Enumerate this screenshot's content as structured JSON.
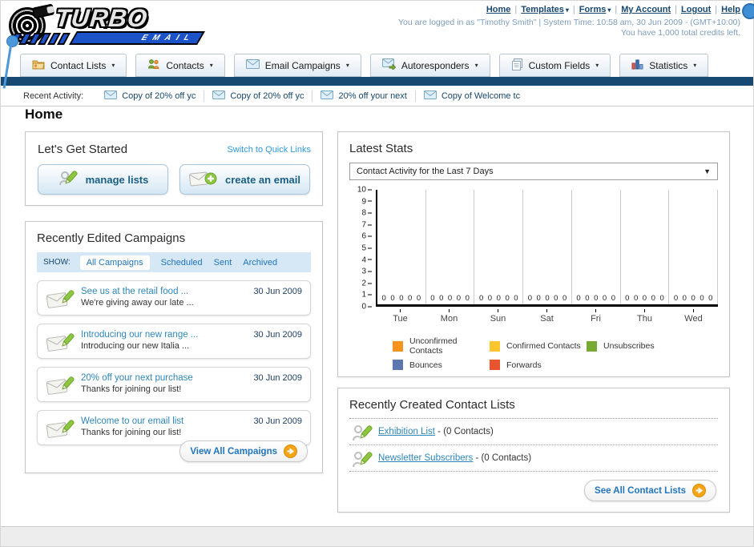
{
  "header": {
    "logo": {
      "title": "TURBO",
      "subtitle": "EMAIL"
    },
    "top_links": [
      {
        "label": "Home",
        "dropdown": false
      },
      {
        "label": "Templates",
        "dropdown": true
      },
      {
        "label": "Forms",
        "dropdown": true
      },
      {
        "label": "My Account",
        "dropdown": false
      },
      {
        "label": "Logout",
        "dropdown": false
      },
      {
        "label": "Help",
        "dropdown": false
      }
    ],
    "login_info": "You are logged in as \"Timothy Smith\" | System Time: 10:58 am, 30 Jun 2009 - (GMT+10:00)",
    "credits_info": "You have 1,000 total credits left."
  },
  "nav_tabs": [
    {
      "label": "Contact Lists",
      "icon": "contact-lists-icon"
    },
    {
      "label": "Contacts",
      "icon": "contacts-icon"
    },
    {
      "label": "Email Campaigns",
      "icon": "email-campaigns-icon"
    },
    {
      "label": "Autoresponders",
      "icon": "autoresponders-icon"
    },
    {
      "label": "Custom Fields",
      "icon": "custom-fields-icon"
    },
    {
      "label": "Statistics",
      "icon": "statistics-icon"
    }
  ],
  "recent_activity": {
    "label": "Recent Activity:",
    "items": [
      "Copy of 20% off yc",
      "Copy of 20% off yc",
      "20% off your next",
      "Copy of Welcome tc"
    ]
  },
  "page_title": "Home",
  "get_started": {
    "title": "Let's Get Started",
    "switch_link": "Switch to Quick Links",
    "buttons": [
      {
        "label": "manage lists",
        "icon": "manage-lists-icon"
      },
      {
        "label": "create an email",
        "icon": "create-email-icon"
      }
    ]
  },
  "campaigns": {
    "title": "Recently Edited Campaigns",
    "show_label": "SHOW:",
    "filters": [
      "All Campaigns",
      "Scheduled",
      "Sent",
      "Archived"
    ],
    "active_filter": "All Campaigns",
    "items": [
      {
        "title": "See us at the retail food ...",
        "subtitle": "We're giving away our late ...",
        "date": "30 Jun 2009"
      },
      {
        "title": "Introducing our new range ...",
        "subtitle": "Introducing our new Italia ...",
        "date": "30 Jun 2009"
      },
      {
        "title": "20% off your next purchase",
        "subtitle": "Thanks for joining our list!",
        "date": "30 Jun 2009"
      },
      {
        "title": "Welcome to our email list",
        "subtitle": "Thanks for joining our list!",
        "date": "30 Jun 2009"
      }
    ],
    "view_all_label": "View All Campaigns"
  },
  "stats": {
    "title": "Latest Stats",
    "dropdown_value": "Contact Activity for the Last 7 Days"
  },
  "chart_data": {
    "type": "bar",
    "title": "Contact Activity for the Last 7 Days",
    "categories": [
      "Tue",
      "Mon",
      "Sun",
      "Sat",
      "Fri",
      "Thu",
      "Wed"
    ],
    "series": [
      {
        "name": "Unconfirmed Contacts",
        "color": "#F6921E",
        "values": [
          0,
          0,
          0,
          0,
          0,
          0,
          0
        ]
      },
      {
        "name": "Confirmed Contacts",
        "color": "#FDC62F",
        "values": [
          0,
          0,
          0,
          0,
          0,
          0,
          0
        ]
      },
      {
        "name": "Unsubscribes",
        "color": "#77A933",
        "values": [
          0,
          0,
          0,
          0,
          0,
          0,
          0
        ]
      },
      {
        "name": "Bounces",
        "color": "#5C77B0",
        "values": [
          0,
          0,
          0,
          0,
          0,
          0,
          0
        ]
      },
      {
        "name": "Forwards",
        "color": "#E8542E",
        "values": [
          0,
          0,
          0,
          0,
          0,
          0,
          0
        ]
      }
    ],
    "ylim": [
      0,
      10
    ],
    "ytick_step": 1,
    "grid": true,
    "legend_position": "bottom",
    "value_labels_shown": true
  },
  "contact_lists": {
    "title": "Recently Created Contact Lists",
    "items": [
      {
        "name": "Exhibition List",
        "detail": "- (0 Contacts)"
      },
      {
        "name": "Newsletter Subscribers",
        "detail": "- (0 Contacts)"
      }
    ],
    "see_all_label": "See All Contact Lists"
  }
}
